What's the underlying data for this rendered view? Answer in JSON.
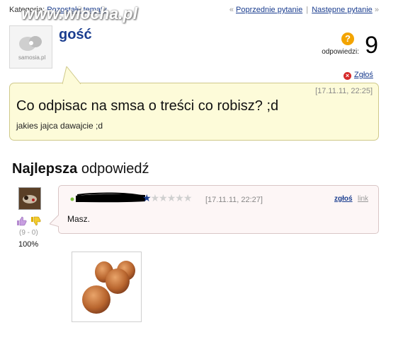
{
  "topbar": {
    "category_label": "Kategoria:",
    "category_link": "Pozostałe tematy",
    "nav_prev": "Poprzednie pytanie",
    "nav_next": "Następne pytanie",
    "nav_sep": "|",
    "nav_left_arrow": "«",
    "nav_right_arrow": "»"
  },
  "watermark": "www.wiocha.pl",
  "question": {
    "avatar_text": "samosia.pl",
    "username": "gość",
    "answers_label": "odpowiedzi:",
    "answers_count": "9",
    "answers_icon": "question-icon",
    "report_label": "Zgłoś",
    "date": "[17.11.11, 22:25]",
    "title": "Co odpisac na smsa o treści co robisz? ;d",
    "body": "jakies jajca dawajcie ;d"
  },
  "best_answer": {
    "heading_bold": "Najlepsza",
    "heading_rest": "odpowiedź",
    "votes": "(9 - 0)",
    "percent": "100%",
    "date": "[17.11.11, 22:27]",
    "report_label": "zgłoś",
    "link_label": "link",
    "text": "Masz.",
    "rating_filled": 1,
    "rating_total": 6,
    "image_icon": "eggs-image"
  },
  "colors": {
    "link": "#1a3d8f",
    "question_bg": "#fdfbd9",
    "answer_bg": "#fdf6f6",
    "accent_orange": "#f3a400",
    "report_red": "#d62b2b"
  }
}
